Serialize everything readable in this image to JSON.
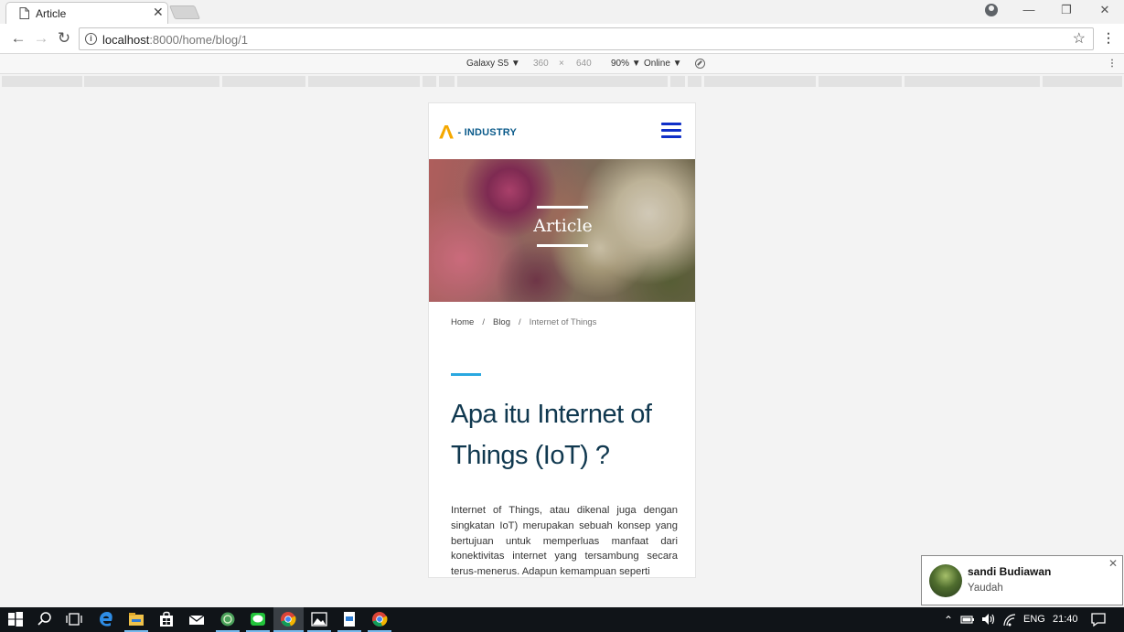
{
  "browser": {
    "tab_title": "Article",
    "url_host": "localhost",
    "url_rest": ":8000/home/blog/1"
  },
  "devtools": {
    "device": "Galaxy S5 ▼",
    "width": "360",
    "times": "×",
    "height": "640",
    "zoom": "90% ▼",
    "network": "Online ▼"
  },
  "site": {
    "logo_mark": "Λ",
    "logo_text": "- INDUSTRY",
    "hero_title": "Article",
    "breadcrumb": {
      "home": "Home",
      "blog": "Blog",
      "current": "Internet of Things",
      "separator": "/"
    },
    "article_title": "Apa itu Internet of Things (IoT) ?",
    "article_body": "Internet of Things, atau dikenal juga dengan singkatan IoT) merupakan sebuah konsep yang bertujuan untuk memperluas manfaat dari konektivitas internet yang tersambung secara terus-menerus. Adapun kemampuan seperti",
    "colors": {
      "logo_accent": "#f5a800",
      "hamburger": "#1030c8",
      "title": "#10384f",
      "accent_line": "#2aa8e0"
    }
  },
  "notification": {
    "sender": "sandi Budiawan",
    "message": "Yaudah"
  },
  "taskbar": {
    "language": "ENG",
    "time": "21:40"
  }
}
